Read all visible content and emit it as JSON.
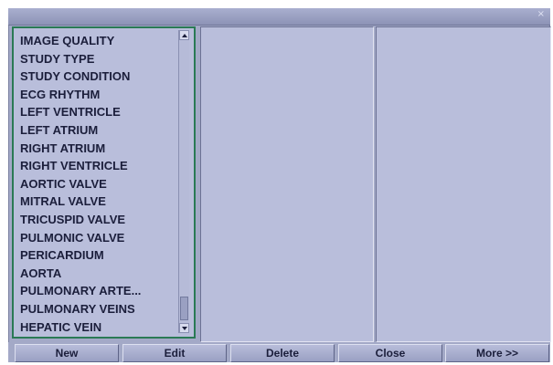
{
  "window": {
    "title": "",
    "close_glyph": "×"
  },
  "list": {
    "items": [
      "IMAGE QUALITY",
      "STUDY TYPE",
      "STUDY CONDITION",
      "ECG RHYTHM",
      "LEFT VENTRICLE",
      "LEFT ATRIUM",
      "RIGHT ATRIUM",
      "RIGHT VENTRICLE",
      "AORTIC VALVE",
      "MITRAL VALVE",
      "TRICUSPID VALVE",
      "PULMONIC VALVE",
      "PERICARDIUM",
      "AORTA",
      "PULMONARY ARTE...",
      "PULMONARY VEINS",
      "HEPATIC VEIN"
    ]
  },
  "buttons": {
    "new": "New",
    "edit": "Edit",
    "delete": "Delete",
    "close": "Close",
    "more": "More >>"
  },
  "icons": {
    "scroll_up": "arrow-up-icon",
    "scroll_down": "arrow-down-icon"
  },
  "colors": {
    "background": "#a3a9c7",
    "panel": "#b9bedb",
    "focus_border": "#2a7a55",
    "text": "#1b1e3b"
  }
}
